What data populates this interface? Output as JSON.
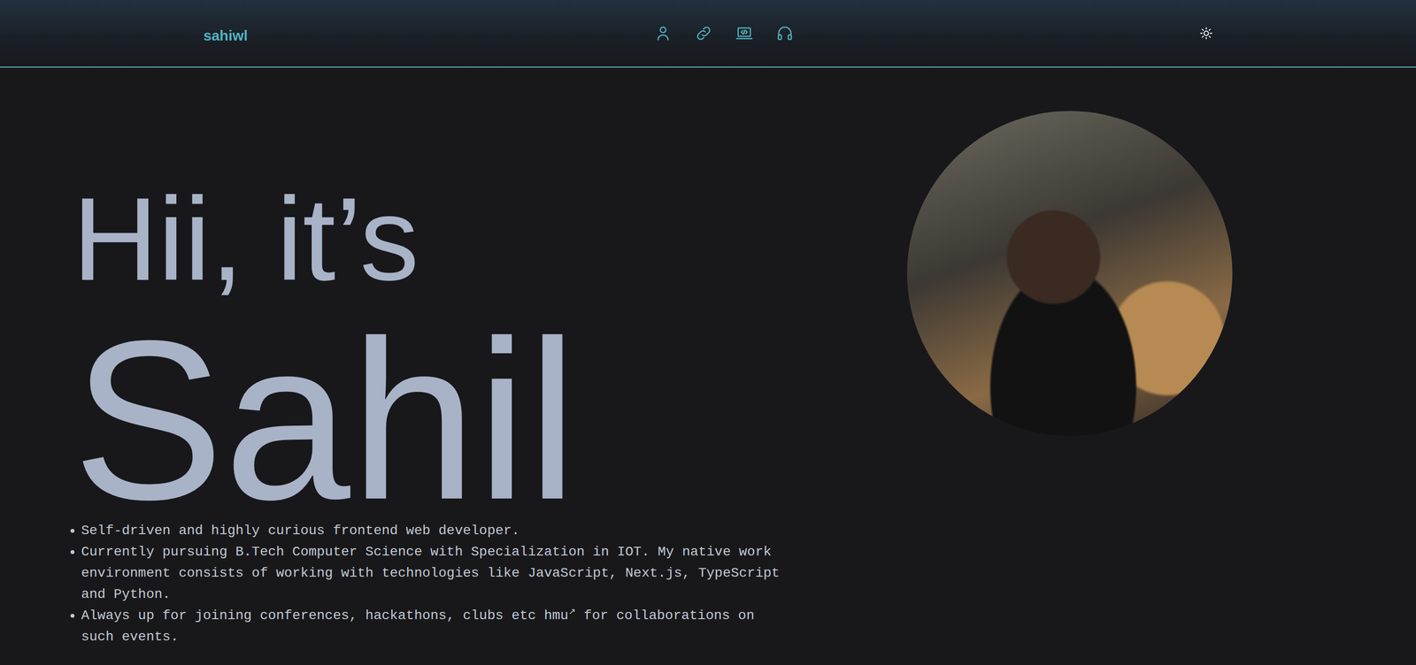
{
  "header": {
    "logo": "sahiwl"
  },
  "hero": {
    "greeting": "Hii, it’s",
    "name": "Sahil"
  },
  "bullets": [
    {
      "parts": [
        {
          "kind": "text",
          "text": "Self-driven and highly curious frontend web developer."
        }
      ]
    },
    {
      "parts": [
        {
          "kind": "text",
          "text": "Currently pursuing B.Tech Computer Science with Specialization in IOT. My native work environment consists of working with technologies like JavaScript, Next.js, TypeScript and Python."
        }
      ]
    },
    {
      "parts": [
        {
          "kind": "text",
          "text": "Always up for joining conferences, hackathons, clubs etc "
        },
        {
          "kind": "link",
          "text": "hmu"
        },
        {
          "kind": "icon",
          "text": "↗"
        },
        {
          "kind": "text",
          "text": " for collaborations on such events."
        }
      ]
    }
  ]
}
